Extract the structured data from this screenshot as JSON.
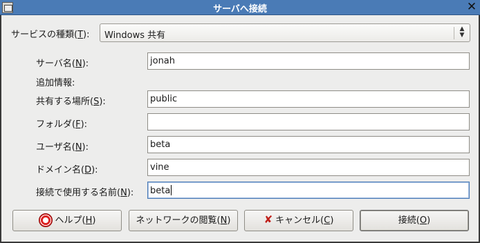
{
  "window": {
    "title": "サーバへ接続",
    "close_glyph": "✕"
  },
  "service": {
    "label_pre": "サービスの種類(",
    "label_key": "T",
    "label_post": "):",
    "value": "Windows 共有"
  },
  "fields": {
    "server": {
      "label_pre": "サーバ名(",
      "label_key": "N",
      "label_post": "):",
      "value": "jonah"
    },
    "extra_heading": "追加情報:",
    "share": {
      "label_pre": "共有する場所(",
      "label_key": "S",
      "label_post": "):",
      "value": "public"
    },
    "folder": {
      "label_pre": "フォルダ(",
      "label_key": "F",
      "label_post": "):",
      "value": ""
    },
    "user": {
      "label_pre": "ユーザ名(",
      "label_key": "N",
      "label_post": "):",
      "value": "beta"
    },
    "domain": {
      "label_pre": "ドメイン名(",
      "label_key": "D",
      "label_post": "):",
      "value": "vine"
    },
    "connect_name": {
      "label_pre": "接続で使用する名前(",
      "label_key": "N",
      "label_post": "):",
      "value": "beta"
    }
  },
  "buttons": {
    "help": {
      "pre": "ヘルプ(",
      "key": "H",
      "post": ")"
    },
    "browse": {
      "pre": "ネットワークの閲覧(",
      "key": "N",
      "post": ")"
    },
    "cancel": {
      "pre": "キャンセル(",
      "key": "C",
      "post": ")"
    },
    "connect": {
      "pre": "接続(",
      "key": "O",
      "post": ")"
    }
  }
}
